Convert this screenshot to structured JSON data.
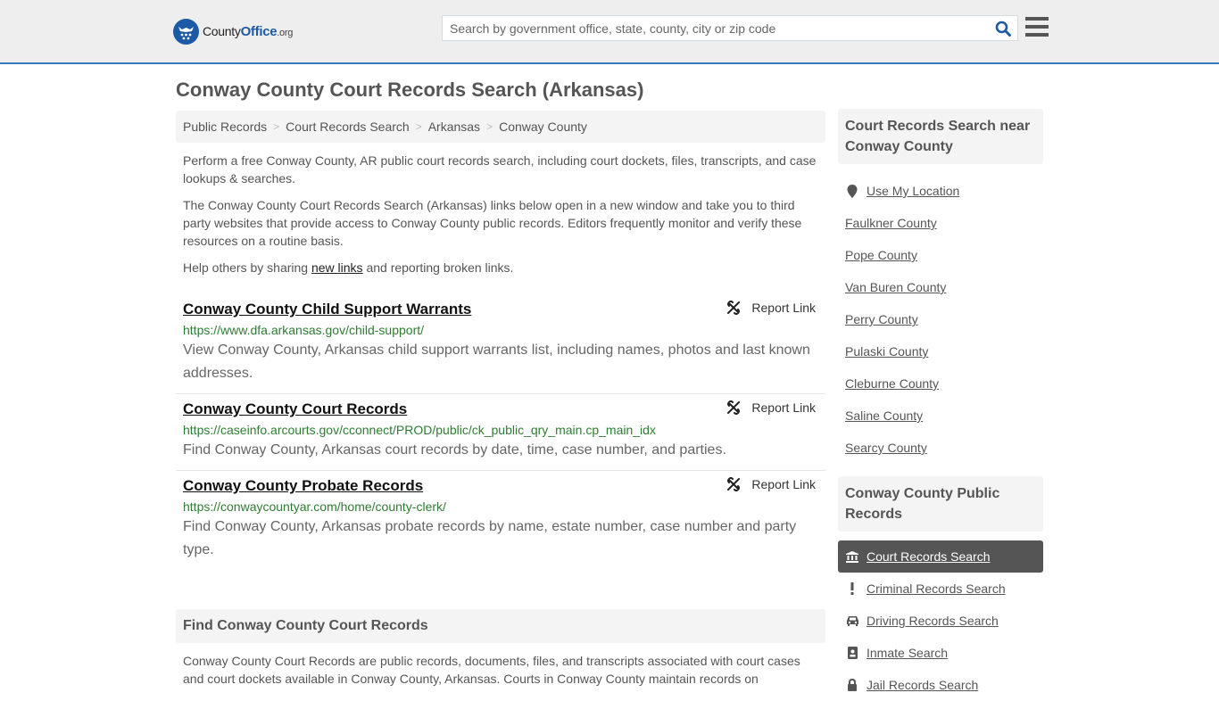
{
  "header": {
    "logo": {
      "county": "County",
      "office": "Office",
      "tld": ".org"
    },
    "search_placeholder": "Search by government office, state, county, city or zip code",
    "search_value": "",
    "icons": {
      "search": "search-icon",
      "menu": "hamburger-menu-icon"
    }
  },
  "page_title": "Conway County Court Records Search (Arkansas)",
  "breadcrumb": [
    "Public Records",
    "Court Records Search",
    "Arkansas",
    "Conway County"
  ],
  "intro": {
    "p1": "Perform a free Conway County, AR public court records search, including court dockets, files, transcripts, and case lookups & searches.",
    "p2": "The Conway County Court Records Search (Arkansas) links below open in a new window and take you to third party websites that provide access to Conway County public records. Editors frequently monitor and verify these resources on a routine basis.",
    "p3_before": "Help others by sharing ",
    "p3_link": "new links",
    "p3_after": " and reporting broken links."
  },
  "results": [
    {
      "title": "Conway County Child Support Warrants",
      "url": "https://www.dfa.arkansas.gov/child-support/",
      "description": "View Conway County, Arkansas child support warrants list, including names, photos and last known addresses.",
      "report_label": "Report Link"
    },
    {
      "title": "Conway County Court Records",
      "url": "https://caseinfo.arcourts.gov/cconnect/PROD/public/ck_public_qry_main.cp_main_idx",
      "description": "Find Conway County, Arkansas court records by date, time, case number, and parties.",
      "report_label": "Report Link"
    },
    {
      "title": "Conway County Probate Records",
      "url": "https://conwaycountyar.com/home/county-clerk/",
      "description": "Find Conway County, Arkansas probate records by name, estate number, case number and party type.",
      "report_label": "Report Link"
    }
  ],
  "find_section": {
    "heading": "Find Conway County Court Records",
    "body": "Conway County Court Records are public records, documents, files, and transcripts associated with court cases and court dockets available in Conway County, Arkansas. Courts in Conway County maintain records on"
  },
  "sidebar": {
    "nearby_heading": "Court Records Search near Conway County",
    "use_location": "Use My Location",
    "nearby": [
      "Faulkner County",
      "Pope County",
      "Van Buren County",
      "Perry County",
      "Pulaski County",
      "Cleburne County",
      "Saline County",
      "Searcy County"
    ],
    "public_records_heading": "Conway County Public Records",
    "public_records": [
      {
        "label": "Court Records Search",
        "icon": "courthouse-icon",
        "active": true
      },
      {
        "label": "Criminal Records Search",
        "icon": "exclamation-icon",
        "active": false
      },
      {
        "label": "Driving Records Search",
        "icon": "car-icon",
        "active": false
      },
      {
        "label": "Inmate Search",
        "icon": "id-badge-icon",
        "active": false
      },
      {
        "label": "Jail Records Search",
        "icon": "lock-icon",
        "active": false
      }
    ]
  },
  "colors": {
    "accent": "#3a7ab8",
    "brand": "#1d5aa6",
    "url_green": "#2e7d32",
    "active_item": "#555555"
  }
}
